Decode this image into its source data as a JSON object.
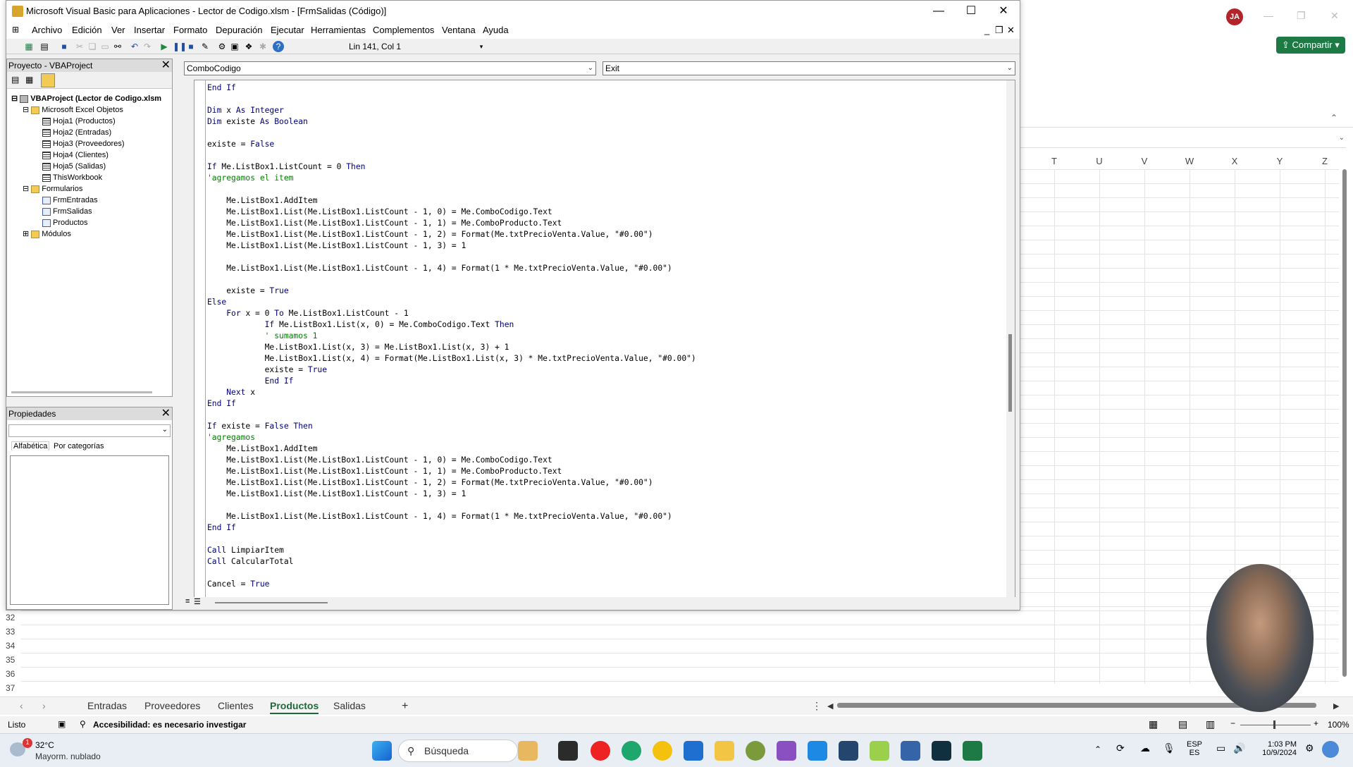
{
  "vbe": {
    "title": "Microsoft Visual Basic para Aplicaciones - Lector de Codigo.xlsm - [FrmSalidas (Código)]",
    "menu": [
      "Archivo",
      "Edición",
      "Ver",
      "Insertar",
      "Formato",
      "Depuración",
      "Ejecutar",
      "Herramientas",
      "Complementos",
      "Ventana",
      "Ayuda"
    ],
    "position": "Lin 141, Col 1",
    "project_title": "Proyecto - VBAProject",
    "project_root": "VBAProject (Lector de Codigo.xlsm",
    "tree": [
      {
        "label": "Microsoft Excel Objetos",
        "level": 1,
        "icon": "folder"
      },
      {
        "label": "Hoja1 (Productos)",
        "level": 2,
        "icon": "sheet"
      },
      {
        "label": "Hoja2 (Entradas)",
        "level": 2,
        "icon": "sheet"
      },
      {
        "label": "Hoja3 (Proveedores)",
        "level": 2,
        "icon": "sheet"
      },
      {
        "label": "Hoja4 (Clientes)",
        "level": 2,
        "icon": "sheet"
      },
      {
        "label": "Hoja5 (Salidas)",
        "level": 2,
        "icon": "sheet"
      },
      {
        "label": "ThisWorkbook",
        "level": 2,
        "icon": "sheet"
      },
      {
        "label": "Formularios",
        "level": 1,
        "icon": "folder"
      },
      {
        "label": "FrmEntradas",
        "level": 2,
        "icon": "form"
      },
      {
        "label": "FrmSalidas",
        "level": 2,
        "icon": "form"
      },
      {
        "label": "Productos",
        "level": 2,
        "icon": "form"
      },
      {
        "label": "Módulos",
        "level": 1,
        "icon": "folder"
      }
    ],
    "props_title": "Propiedades",
    "props_tabs": [
      "Alfabética",
      "Por categorías"
    ],
    "object_combo": "ComboCodigo",
    "proc_combo": "Exit",
    "code": [
      [
        [
          "kw",
          "End If"
        ]
      ],
      [],
      [
        [
          "kw",
          "Dim"
        ],
        [
          "",
          "x "
        ],
        [
          "kw",
          "As Integer"
        ]
      ],
      [
        [
          "kw",
          "Dim"
        ],
        [
          "",
          "existe "
        ],
        [
          "kw",
          "As Boolean"
        ]
      ],
      [],
      [
        [
          "",
          "existe = "
        ],
        [
          "kw",
          "False"
        ]
      ],
      [],
      [
        [
          "kw",
          "If"
        ],
        [
          "",
          "Me.ListBox1.ListCount = 0 "
        ],
        [
          "kw",
          "Then"
        ]
      ],
      [
        [
          "cm",
          "'agregamos el item"
        ]
      ],
      [],
      [
        [
          "",
          "    Me.ListBox1.AddItem"
        ]
      ],
      [
        [
          "",
          "    Me.ListBox1.List(Me.ListBox1.ListCount - 1, 0) = Me.ComboCodigo.Text"
        ]
      ],
      [
        [
          "",
          "    Me.ListBox1.List(Me.ListBox1.ListCount - 1, 1) = Me.ComboProducto.Text"
        ]
      ],
      [
        [
          "",
          "    Me.ListBox1.List(Me.ListBox1.ListCount - 1, 2) = Format(Me.txtPrecioVenta.Value, \"#0.00\")"
        ]
      ],
      [
        [
          "",
          "    Me.ListBox1.List(Me.ListBox1.ListCount - 1, 3) = 1"
        ]
      ],
      [],
      [
        [
          "",
          "    Me.ListBox1.List(Me.ListBox1.ListCount - 1, 4) = Format(1 * Me.txtPrecioVenta.Value, \"#0.00\")"
        ]
      ],
      [],
      [
        [
          "",
          "    existe = "
        ],
        [
          "kw",
          "True"
        ]
      ],
      [
        [
          "kw",
          "Else"
        ]
      ],
      [
        [
          "",
          "    "
        ],
        [
          "kw",
          "For"
        ],
        [
          "",
          "x = 0 "
        ],
        [
          "kw",
          "To"
        ],
        [
          "",
          "Me.ListBox1.ListCount - 1"
        ]
      ],
      [
        [
          "",
          "            "
        ],
        [
          "kw",
          "If"
        ],
        [
          "",
          "Me.ListBox1.List(x, 0) = Me.ComboCodigo.Text "
        ],
        [
          "kw",
          "Then"
        ]
      ],
      [
        [
          "",
          "            "
        ],
        [
          "cm",
          "' sumamos 1"
        ]
      ],
      [
        [
          "",
          "            Me.ListBox1.List(x, 3) = Me.ListBox1.List(x, 3) + 1"
        ]
      ],
      [
        [
          "",
          "            Me.ListBox1.List(x, 4) = Format(Me.ListBox1.List(x, 3) * Me.txtPrecioVenta.Value, \"#0.00\")"
        ]
      ],
      [
        [
          "",
          "            existe = "
        ],
        [
          "kw",
          "True"
        ]
      ],
      [
        [
          "",
          "            "
        ],
        [
          "kw",
          "End If"
        ]
      ],
      [
        [
          "",
          "    "
        ],
        [
          "kw",
          "Next"
        ],
        [
          "",
          "x"
        ]
      ],
      [
        [
          "kw",
          "End If"
        ]
      ],
      [],
      [
        [
          "kw",
          "If"
        ],
        [
          "",
          "existe = "
        ],
        [
          "kw",
          "False Then"
        ]
      ],
      [
        [
          "cm",
          "'agregamos"
        ]
      ],
      [
        [
          "",
          "    Me.ListBox1.AddItem"
        ]
      ],
      [
        [
          "",
          "    Me.ListBox1.List(Me.ListBox1.ListCount - 1, 0) = Me.ComboCodigo.Text"
        ]
      ],
      [
        [
          "",
          "    Me.ListBox1.List(Me.ListBox1.ListCount - 1, 1) = Me.ComboProducto.Text"
        ]
      ],
      [
        [
          "",
          "    Me.ListBox1.List(Me.ListBox1.ListCount - 1, 2) = Format(Me.txtPrecioVenta.Value, \"#0.00\")"
        ]
      ],
      [
        [
          "",
          "    Me.ListBox1.List(Me.ListBox1.ListCount - 1, 3) = 1"
        ]
      ],
      [],
      [
        [
          "",
          "    Me.ListBox1.List(Me.ListBox1.ListCount - 1, 4) = Format(1 * Me.txtPrecioVenta.Value, \"#0.00\")"
        ]
      ],
      [
        [
          "kw",
          "End If"
        ]
      ],
      [],
      [
        [
          "kw",
          "Call"
        ],
        [
          "",
          "LimpiarItem"
        ]
      ],
      [
        [
          "kw",
          "Call"
        ],
        [
          "",
          "CalcularTotal"
        ]
      ],
      [],
      [
        [
          "",
          "Cancel = "
        ],
        [
          "kw",
          "True"
        ]
      ]
    ]
  },
  "excel": {
    "avatar": "JA",
    "share": "Compartir",
    "columns": [
      "T",
      "U",
      "V",
      "W",
      "X",
      "Y",
      "Z"
    ],
    "rows": [
      "32",
      "33",
      "34",
      "35",
      "36",
      "37"
    ],
    "sheets": [
      "Entradas",
      "Proveedores",
      "Clientes",
      "Productos",
      "Salidas"
    ],
    "active_sheet": "Productos",
    "status": "Listo",
    "accessibility": "Accesibilidad: es necesario investigar",
    "zoom": "100%"
  },
  "taskbar": {
    "weather_temp": "32°C",
    "weather_desc": "Mayorm. nublado",
    "weather_badge": "1",
    "search": "Búsqueda",
    "lang1": "ESP",
    "lang2": "ES",
    "time": "1:03 PM",
    "date": "10/9/2024"
  }
}
